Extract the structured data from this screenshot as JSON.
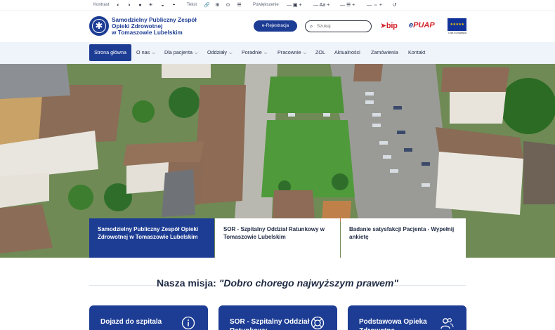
{
  "a11y": {
    "contrast_label": "Kontrast",
    "text_label": "Tekst",
    "zoom_label": "Powiększenie",
    "font_size_label": "Aa"
  },
  "header": {
    "logo_line1": "Samodzielny Publiczny Zespół",
    "logo_line2": "Opieki Zdrowotnej",
    "logo_line3": "w Tomaszowie Lubelskim",
    "register_button": "e-Rejestracja",
    "search_placeholder": "Szukaj",
    "bip": "bip",
    "epuap": "PUAP",
    "epuap_e": "e",
    "eu_caption": "Unia Europejska"
  },
  "nav": {
    "items": [
      {
        "label": "Strona główna",
        "dropdown": false,
        "active": true
      },
      {
        "label": "O nas",
        "dropdown": true
      },
      {
        "label": "Dla pacjenta",
        "dropdown": true
      },
      {
        "label": "Oddziały",
        "dropdown": true
      },
      {
        "label": "Poradnie",
        "dropdown": true
      },
      {
        "label": "Pracownie",
        "dropdown": true
      },
      {
        "label": "ZOL",
        "dropdown": false
      },
      {
        "label": "Aktualności",
        "dropdown": false
      },
      {
        "label": "Zamówienia",
        "dropdown": false
      },
      {
        "label": "Kontakt",
        "dropdown": false
      }
    ]
  },
  "hero_cards": [
    "Samodzielny Publiczny Zespół Opieki Zdrowotnej w Tomaszowie Lubelskim",
    "SOR - Szpitalny Oddział Ratunkowy w Tomaszowie Lubelskim",
    "Badanie satysfakcji Pacjenta - Wypełnij ankietę"
  ],
  "mission": {
    "prefix": "Nasza misja: ",
    "quote": "\"Dobro chorego najwyższym prawem\""
  },
  "quick_cards": [
    {
      "label": "Dojazd do szpitala",
      "icon": "info-icon"
    },
    {
      "label": "SOR - Szpitalny Oddział Ratunkowy",
      "icon": "lifebuoy-icon"
    },
    {
      "label": "Podstawowa Opieka Zdrowotna",
      "icon": "people-icon"
    }
  ],
  "colors": {
    "brand": "#1d3d94",
    "nav_bg": "#eff3fa",
    "bip_red": "#d1232a"
  }
}
